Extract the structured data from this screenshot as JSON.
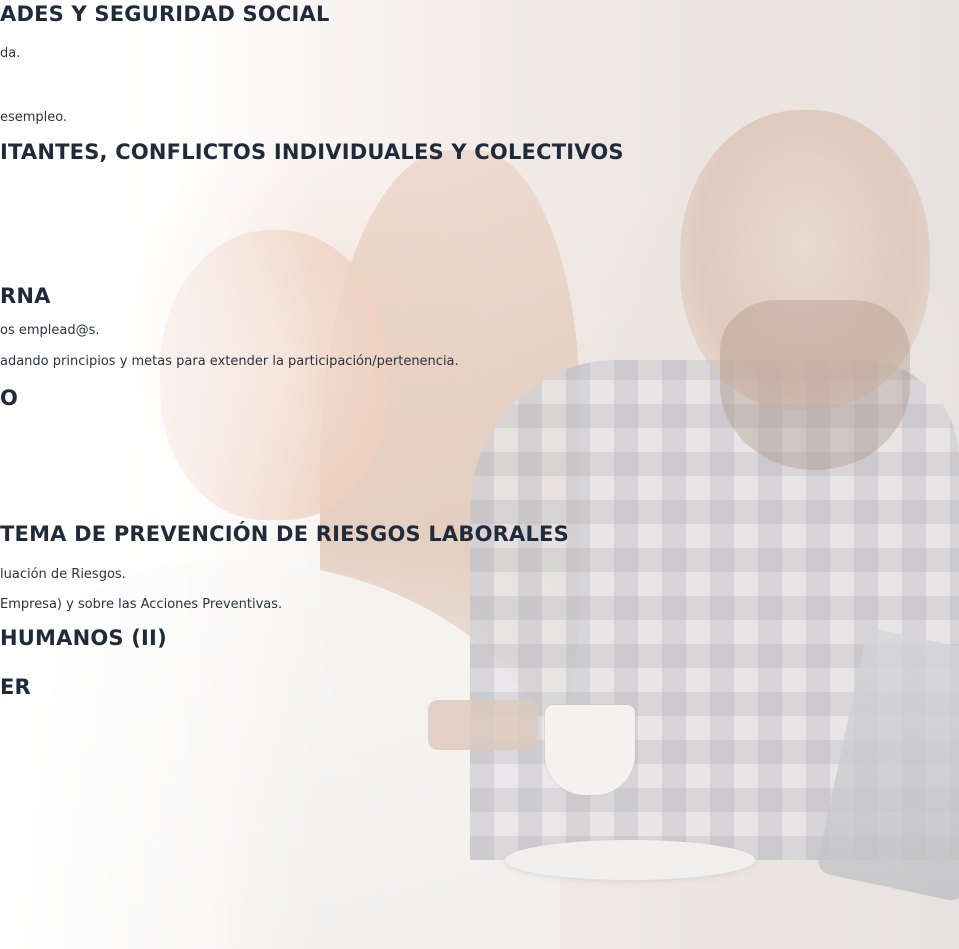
{
  "headings": {
    "h1": "ADES Y SEGURIDAD SOCIAL",
    "h2": "ITANTES, CONFLICTOS INDIVIDUALES Y COLECTIVOS",
    "h3": "RNA",
    "h4": "O",
    "h5": "TEMA DE PREVENCIÓN DE RIESGOS LABORALES",
    "h6": "HUMANOS (II)",
    "h7": "ER"
  },
  "lines": {
    "l1": "da.",
    "l2": "esempleo.",
    "l3": "os emplead@s.",
    "l4": "adando principios y metas para extender la participación/pertenencia.",
    "l5": "luación de Riesgos.",
    "l6": "Empresa) y sobre las Acciones Preventivas."
  }
}
